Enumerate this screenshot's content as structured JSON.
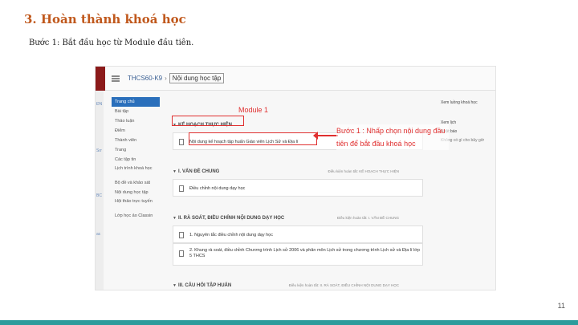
{
  "slide": {
    "title": "3. Hoàn thành khoá học",
    "subtitle": "Bước 1: Bắt đầu học từ Module đầu tiên.",
    "page_number": "11"
  },
  "app": {
    "breadcrumb": {
      "course": "THCS60-K9",
      "current": "Nội dung học tập"
    },
    "left_col_items": [
      "ĐN",
      "Sơ",
      "BC",
      "ac"
    ]
  },
  "sidebar": {
    "items": [
      {
        "label": "Trang chủ",
        "active": true
      },
      {
        "label": "Bài tập",
        "active": false
      },
      {
        "label": "Thảo luận",
        "active": false
      },
      {
        "label": "Điểm",
        "active": false
      },
      {
        "label": "Thành viên",
        "active": false
      },
      {
        "label": "Trang",
        "active": false
      },
      {
        "label": "Các tập tin",
        "active": false
      },
      {
        "label": "Lịch trình khoá học",
        "active": false
      },
      {
        "label": "Bộ đề và khảo sát",
        "active": false
      },
      {
        "label": "Nội dung học tập",
        "active": false
      },
      {
        "label": "Hội thảo trực tuyến",
        "active": false
      },
      {
        "label": "Lớp học ảo Classin",
        "active": false
      }
    ]
  },
  "sections": [
    {
      "title": "KẾ HOẠCH THỰC HIỆN",
      "meta": "",
      "items": [
        "Nội dung kế hoạch tập huấn Giáo viên Lịch Sử và Địa lí"
      ]
    },
    {
      "title": "I. VẤN ĐỀ CHUNG",
      "meta": "Điều kiện hoàn tất: KẾ HOẠCH THỰC HIỆN",
      "items": [
        "Điều chỉnh nội dung dạy học"
      ]
    },
    {
      "title": "II. RÀ SOÁT, ĐIỀU CHỈNH NỘI DUNG DẠY HỌC",
      "meta": "Điều kiện hoàn tất: I. VẤN ĐỀ CHUNG",
      "items": [
        "1. Nguyên tắc điều chỉnh nội dung dạy học",
        "2. Khung rà soát, điều chỉnh Chương trình Lịch sử 2006 và phân môn Lịch sử trong chương trình Lịch sử và Địa lí lớp 5 THCS"
      ]
    },
    {
      "title": "III. CÂU HỎI TẬP HUẤN",
      "meta": "Điều kiện hoàn tất: II. RÀ SOÁT, ĐIỀU CHỈNH NỘI DUNG DẠY HỌC",
      "items": []
    }
  ],
  "right_panel": {
    "items": [
      "Xem luồng khoá học",
      "Xem lịch",
      "Nhật báo"
    ],
    "note": "Không có gì cho bây giờ"
  },
  "annotations": {
    "module": "Module 1",
    "step": "Bước 1 : Nhấp chọn nội dung đầu tiên để bắt đầu khoá học"
  },
  "colors": {
    "title": "#c0581c",
    "accent_bar": "#2c9c9c",
    "annotation": "#e03030",
    "sidebar_active": "#2a6fbb"
  }
}
